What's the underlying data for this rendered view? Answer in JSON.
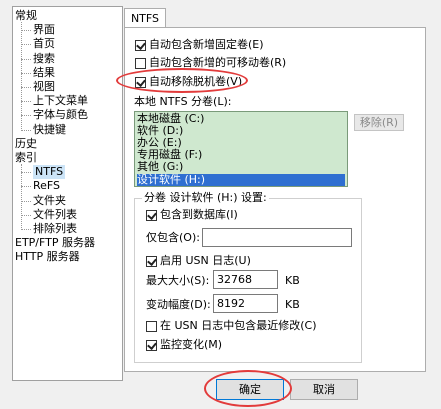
{
  "tree": {
    "items": [
      {
        "label": "常规",
        "level": 0
      },
      {
        "label": "界面",
        "level": 1
      },
      {
        "label": "首页",
        "level": 1
      },
      {
        "label": "搜索",
        "level": 1
      },
      {
        "label": "结果",
        "level": 1
      },
      {
        "label": "视图",
        "level": 1
      },
      {
        "label": "上下文菜单",
        "level": 1
      },
      {
        "label": "字体与颜色",
        "level": 1
      },
      {
        "label": "快捷键",
        "level": 1
      },
      {
        "label": "历史",
        "level": 0
      },
      {
        "label": "索引",
        "level": 0
      },
      {
        "label": "NTFS",
        "level": 1,
        "selected": true
      },
      {
        "label": "ReFS",
        "level": 1
      },
      {
        "label": "文件夹",
        "level": 1
      },
      {
        "label": "文件列表",
        "level": 1
      },
      {
        "label": "排除列表",
        "level": 1
      },
      {
        "label": "ETP/FTP 服务器",
        "level": 0
      },
      {
        "label": "HTTP 服务器",
        "level": 0
      }
    ]
  },
  "tab": {
    "label": "NTFS"
  },
  "options": {
    "auto_include_fixed": {
      "label": "自动包含新增固定卷(E)",
      "checked": true
    },
    "auto_include_removable": {
      "label": "自动包含新增的可移动卷(R)",
      "checked": false
    },
    "auto_remove_offline": {
      "label": "自动移除脱机卷(V)",
      "checked": true
    }
  },
  "volumes": {
    "label": "本地 NTFS 分卷(L):",
    "items": [
      "本地磁盘 (C:)",
      "软件 (D:)",
      "办公 (E:)",
      "专用磁盘 (F:)",
      "其他 (G:)",
      "设计软件 (H:)"
    ],
    "selected_index": 5,
    "remove_button": "移除(R)"
  },
  "settings": {
    "title": "分卷 设计软件 (H:) 设置:",
    "include_in_db": {
      "label": "包含到数据库(I)",
      "checked": true
    },
    "include_only_label": "仅包含(O):",
    "include_only_value": "",
    "enable_usn": {
      "label": "启用 USN 日志(U)",
      "checked": true
    },
    "max_size_label": "最大大小(S):",
    "max_size_value": "32768",
    "max_size_unit": "KB",
    "delta_label": "变动幅度(D):",
    "delta_value": "8192",
    "delta_unit": "KB",
    "usn_recent": {
      "label": "在 USN 日志中包含最近修改(C)",
      "checked": false
    },
    "monitor": {
      "label": "监控变化(M)",
      "checked": true
    }
  },
  "buttons": {
    "ok": "确定",
    "cancel": "取消"
  },
  "colors": {
    "highlight_oval": "#e23b3b",
    "list_bg": "#cfe8cf",
    "selection": "#2f6fd1"
  }
}
